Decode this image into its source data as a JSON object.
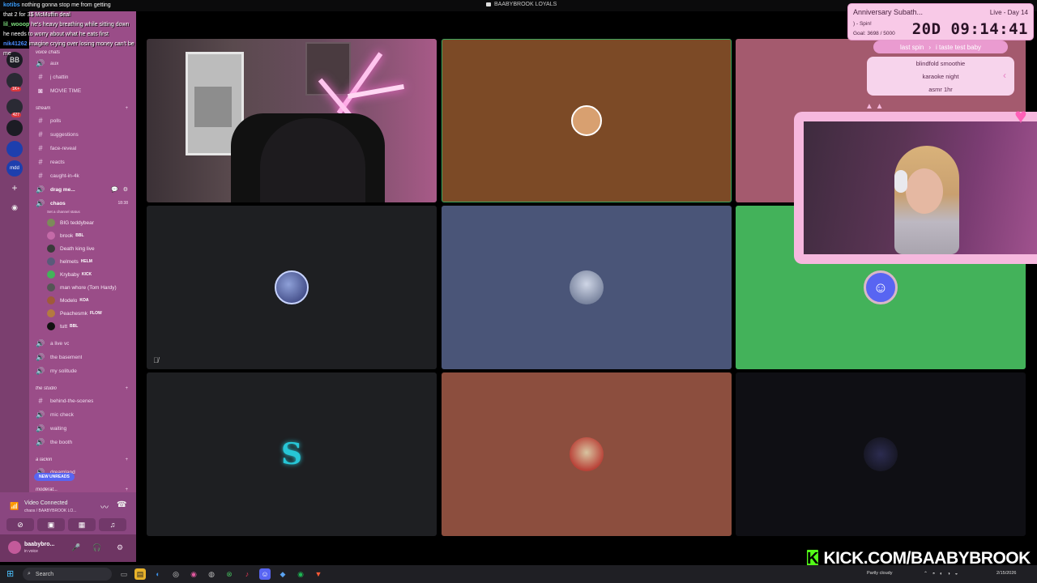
{
  "title_bar": {
    "server_name": "BAABYBROOK LOYALS"
  },
  "chat_overlay": [
    {
      "name": "kotibs",
      "message": "nothing gonna stop me from getting",
      "name_color": "#3ea0ff"
    },
    {
      "name": "",
      "message": "that 2 for 3$ McMuffin deal",
      "name_color": "#ffffff"
    },
    {
      "name": "lil_wooop",
      "message": "he's heavy breathing while sitting down",
      "name_color": "#7ee07e"
    },
    {
      "name": "",
      "message": "he needs to worry about what he eats first",
      "name_color": "#ffffff"
    },
    {
      "name": "nik41262",
      "message": "imagine crying over losing money can't be",
      "name_color": "#4a8cff"
    },
    {
      "name": "",
      "message": "me",
      "name_color": "#ffffff"
    }
  ],
  "rail": {
    "servers": [
      {
        "icon": "server-icon",
        "label": "BB",
        "badge": ""
      },
      {
        "icon": "server-icon",
        "label": "",
        "badge": "1K+"
      },
      {
        "icon": "server-icon",
        "label": "",
        "badge": "427"
      },
      {
        "icon": "server-icon",
        "label": "",
        "badge": ""
      },
      {
        "icon": "server-icon",
        "label": "",
        "badge": ""
      },
      {
        "icon": "server-icon",
        "label": "mdd",
        "badge": ""
      },
      {
        "icon": "add-server-icon",
        "label": "+",
        "badge": ""
      },
      {
        "icon": "explore-icon",
        "label": "◉",
        "badge": ""
      }
    ]
  },
  "sidebar": {
    "items": [
      {
        "type": "category",
        "label": "voice chats"
      },
      {
        "type": "text",
        "label": "aux"
      },
      {
        "type": "text",
        "label": "j chattin"
      },
      {
        "type": "text",
        "label": "MOVIE TIME"
      },
      {
        "type": "category",
        "label": "stream"
      },
      {
        "type": "text",
        "label": "polls"
      },
      {
        "type": "text",
        "label": "suggestions"
      },
      {
        "type": "text",
        "label": "face-reveal"
      },
      {
        "type": "text",
        "label": "reacts"
      },
      {
        "type": "text",
        "label": "caught-in-4k"
      },
      {
        "type": "voice",
        "label": "drag me..."
      },
      {
        "type": "voice-active",
        "label": "chaos",
        "time": "18:38"
      },
      {
        "type": "status",
        "label": "Set a channel status"
      },
      {
        "type": "user",
        "label": "BIG teddybear",
        "tag": ""
      },
      {
        "type": "user",
        "label": "brook",
        "tag": "BBL"
      },
      {
        "type": "user",
        "label": "Death king live",
        "tag": ""
      },
      {
        "type": "user",
        "label": "helmets",
        "tag": "HELM"
      },
      {
        "type": "user",
        "label": "Krybaby",
        "tag": "KICK"
      },
      {
        "type": "user",
        "label": "man whore (Tom Hardy)",
        "tag": ""
      },
      {
        "type": "user",
        "label": "Modelo",
        "tag": "KOA"
      },
      {
        "type": "user",
        "label": "Peachesmk",
        "tag": "FLOW"
      },
      {
        "type": "user",
        "label": "tutt",
        "tag": "BBL"
      },
      {
        "type": "voice",
        "label": "a live vc"
      },
      {
        "type": "voice",
        "label": "the basement"
      },
      {
        "type": "voice",
        "label": "my solitude"
      },
      {
        "type": "category",
        "label": "the studio"
      },
      {
        "type": "text",
        "label": "behind-the-scenes"
      },
      {
        "type": "voice",
        "label": "mic check"
      },
      {
        "type": "voice",
        "label": "waiting"
      },
      {
        "type": "voice",
        "label": "the booth"
      },
      {
        "type": "category",
        "label": "a lackin"
      },
      {
        "type": "text",
        "label": "dreamland"
      },
      {
        "type": "category",
        "label": "moderat..."
      }
    ],
    "new_unreads": "NEW UNREADS"
  },
  "voice_panel": {
    "status": "Video Connected",
    "channel": "chaos / BAABYBROOK LO..."
  },
  "user_panel": {
    "username": "baabybro...",
    "status": "in voice"
  },
  "tiles": [
    {
      "kind": "camera",
      "bg": "#3b3136"
    },
    {
      "kind": "avatar",
      "bg": "#7c4a26",
      "avatar_color": "#d8a070"
    },
    {
      "kind": "avatar",
      "bg": "#a45a6e",
      "avatar_color": "#a45a6e"
    },
    {
      "kind": "avatar",
      "bg": "#1e1f22",
      "avatar_color": "#5b6b9a",
      "muted": true
    },
    {
      "kind": "avatar",
      "bg": "#4a5578",
      "avatar_color": "#9aa8c6"
    },
    {
      "kind": "avatar",
      "bg": "#43b25a",
      "avatar_color": "#5865f2"
    },
    {
      "kind": "avatar",
      "bg": "#1e1f22",
      "avatar_color": "#27c6d6",
      "letter": "S"
    },
    {
      "kind": "avatar",
      "bg": "#8c4e3e",
      "avatar_color": "#b94238"
    },
    {
      "kind": "avatar",
      "bg": "#0f0f14",
      "avatar_color": "#1a1a2e"
    }
  ],
  "subathon": {
    "title": "Anniversary Subath...",
    "day": "Live - Day 14",
    "spin_label": ") - Spin!",
    "goal": "Goal: 3698 / 5000",
    "timer": "20D 09:14:41"
  },
  "spin": {
    "last_spin_label": "last spin",
    "last_spin_value": "i taste test baby"
  },
  "wheel_options": [
    "blindfold smoothie",
    "karaoke night",
    "asmr 1hr"
  ],
  "kick": {
    "logo": "K",
    "url": "KICK.COM/BAABYBROOK"
  },
  "taskbar": {
    "search_placeholder": "Search",
    "weather": "Partly cloudy",
    "date": "2/15/2026"
  }
}
